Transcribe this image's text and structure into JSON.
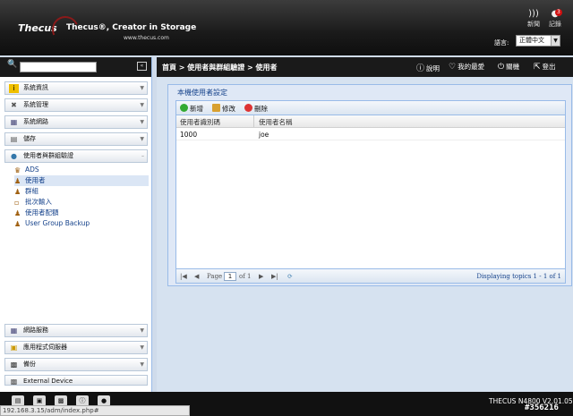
{
  "header": {
    "brand": "Thecus",
    "tagline": "Thecus®, Creator in Storage",
    "site": "www.thecus.com",
    "news_label": "新聞",
    "log_label": "記錄",
    "log_badge": "3",
    "lang_label": "語言:",
    "lang_value": "正體中文"
  },
  "sidebar": {
    "sections": [
      {
        "label": "系統資訊",
        "icon": "info-icon"
      },
      {
        "label": "系統管理",
        "icon": "tools-icon"
      },
      {
        "label": "系統網路",
        "icon": "network-icon"
      },
      {
        "label": "儲存",
        "icon": "storage-icon"
      },
      {
        "label": "使用者與群組驗證",
        "icon": "users-icon"
      },
      {
        "label": "網路服務",
        "icon": "network-service-icon"
      },
      {
        "label": "應用程式伺服器",
        "icon": "app-server-icon"
      },
      {
        "label": "備份",
        "icon": "backup-icon"
      },
      {
        "label": "External Device",
        "icon": "device-icon"
      }
    ],
    "tree": [
      {
        "label": "ADS"
      },
      {
        "label": "使用者"
      },
      {
        "label": "群組"
      },
      {
        "label": "批次輸入"
      },
      {
        "label": "使用者配額"
      },
      {
        "label": "User Group Backup"
      }
    ]
  },
  "topbar": {
    "breadcrumb": "首頁 > 使用者與群組驗證 > 使用者",
    "help": "說明",
    "favorite": "我的最愛",
    "shutdown": "關機",
    "logout": "登出"
  },
  "panel": {
    "title": "本機使用者設定",
    "toolbar": {
      "add": "新增",
      "edit": "修改",
      "delete": "刪除"
    },
    "columns": [
      "使用者識別碼",
      "使用者名稱"
    ],
    "rows": [
      {
        "id": "1000",
        "name": "joe"
      }
    ],
    "pager": {
      "page_label": "Page",
      "page_value": "1",
      "of_label": "of 1",
      "display": "Displaying topics 1 - 1 of 1"
    }
  },
  "footer": {
    "version": "THECUS N4800 V2.01.05",
    "status_url": "192.168.3.15/adm/index.php#",
    "watermark": "#356216"
  },
  "colors": {
    "accent": "#15428b",
    "badge": "#d01010",
    "header_bg": "#1a1a1a"
  }
}
